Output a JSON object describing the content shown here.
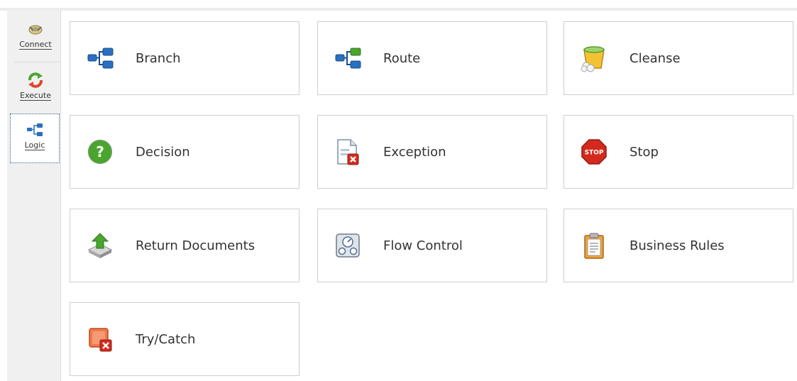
{
  "sidebar": {
    "items": [
      {
        "label": "Connect",
        "icon": "connect-icon"
      },
      {
        "label": "Execute",
        "icon": "execute-icon"
      },
      {
        "label": "Logic",
        "icon": "logic-icon",
        "active": true
      }
    ]
  },
  "tiles": [
    {
      "label": "Branch",
      "icon": "branch-icon"
    },
    {
      "label": "Route",
      "icon": "route-icon"
    },
    {
      "label": "Cleanse",
      "icon": "cleanse-icon"
    },
    {
      "label": "Decision",
      "icon": "decision-icon"
    },
    {
      "label": "Exception",
      "icon": "exception-icon"
    },
    {
      "label": "Stop",
      "icon": "stop-icon",
      "icon_text": "STOP"
    },
    {
      "label": "Return Documents",
      "icon": "return-documents-icon"
    },
    {
      "label": "Flow Control",
      "icon": "flow-control-icon"
    },
    {
      "label": "Business Rules",
      "icon": "business-rules-icon"
    },
    {
      "label": "Try/Catch",
      "icon": "try-catch-icon"
    }
  ],
  "colors": {
    "sidebar_bg": "#f0f0f0",
    "tile_border": "#cfcfcf",
    "active_border": "#2f5f8a",
    "branch_blue": "#2a6fc0",
    "route_green": "#4aa52e",
    "stop_red": "#d42a1e"
  }
}
